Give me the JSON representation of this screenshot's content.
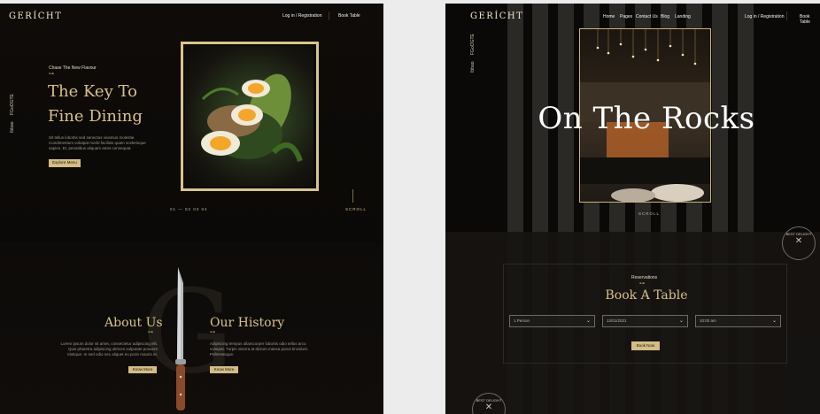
{
  "left": {
    "logo": "GERÍCHT",
    "nav": {
      "login": "Log in / Registration",
      "book_table": "Book Table"
    },
    "social": [
      "Ibbao",
      "FGoOGTE"
    ],
    "hero": {
      "tagline": "Chase The New Flavour",
      "title_line1": "The Key To",
      "title_line2": "Fine Dining",
      "body": "Sit tellus lobortis sed senectus vivamus molestie. Condimentum volutpat morbi facilisis quam scelerisque sapien. Et, penatibus aliquam amet consequat.",
      "button": "Explore Menu",
      "slider_dots": "01 — 02 03 04",
      "scroll": "SCROLL"
    },
    "about": {
      "title": "About Us",
      "body": "Lorem ipsum dolor sit amet, consectetur adipiscing elit. Quis pharetra adipiscing ultrices vulputate posuere tristique. In sed odio nec aliquet eu proin mauris et.",
      "button": "Know More",
      "bg_letter": "G"
    },
    "history": {
      "title": "Our History",
      "body": "Adipiscing tempus ullamcorper lobortis odio tellus arcu volutpat. Turpis viverra at dictum massa purus tincidunt. Pellentesque.",
      "button": "Know More"
    }
  },
  "right": {
    "logo": "GERÍCHT",
    "nav": [
      "Home",
      "Pages",
      "Contact Us",
      "Blog",
      "Landing"
    ],
    "login": "Log in / Registration",
    "book_table": "Book Table",
    "social": [
      "Ibbao",
      "FGoOGTE"
    ],
    "hero_title": "On The Rocks",
    "scroll": "SCROLL",
    "badge": "BEST DELIGHT",
    "reservation": {
      "subtitle": "Reservations",
      "title": "Book A Table",
      "fields": [
        "1 Person",
        "12/01/2021",
        "10:00 am"
      ],
      "button": "Book Now"
    }
  },
  "colors": {
    "gold": "#DCCA87",
    "dark": "#0C0C0C",
    "muted": "#AAAAAA"
  }
}
